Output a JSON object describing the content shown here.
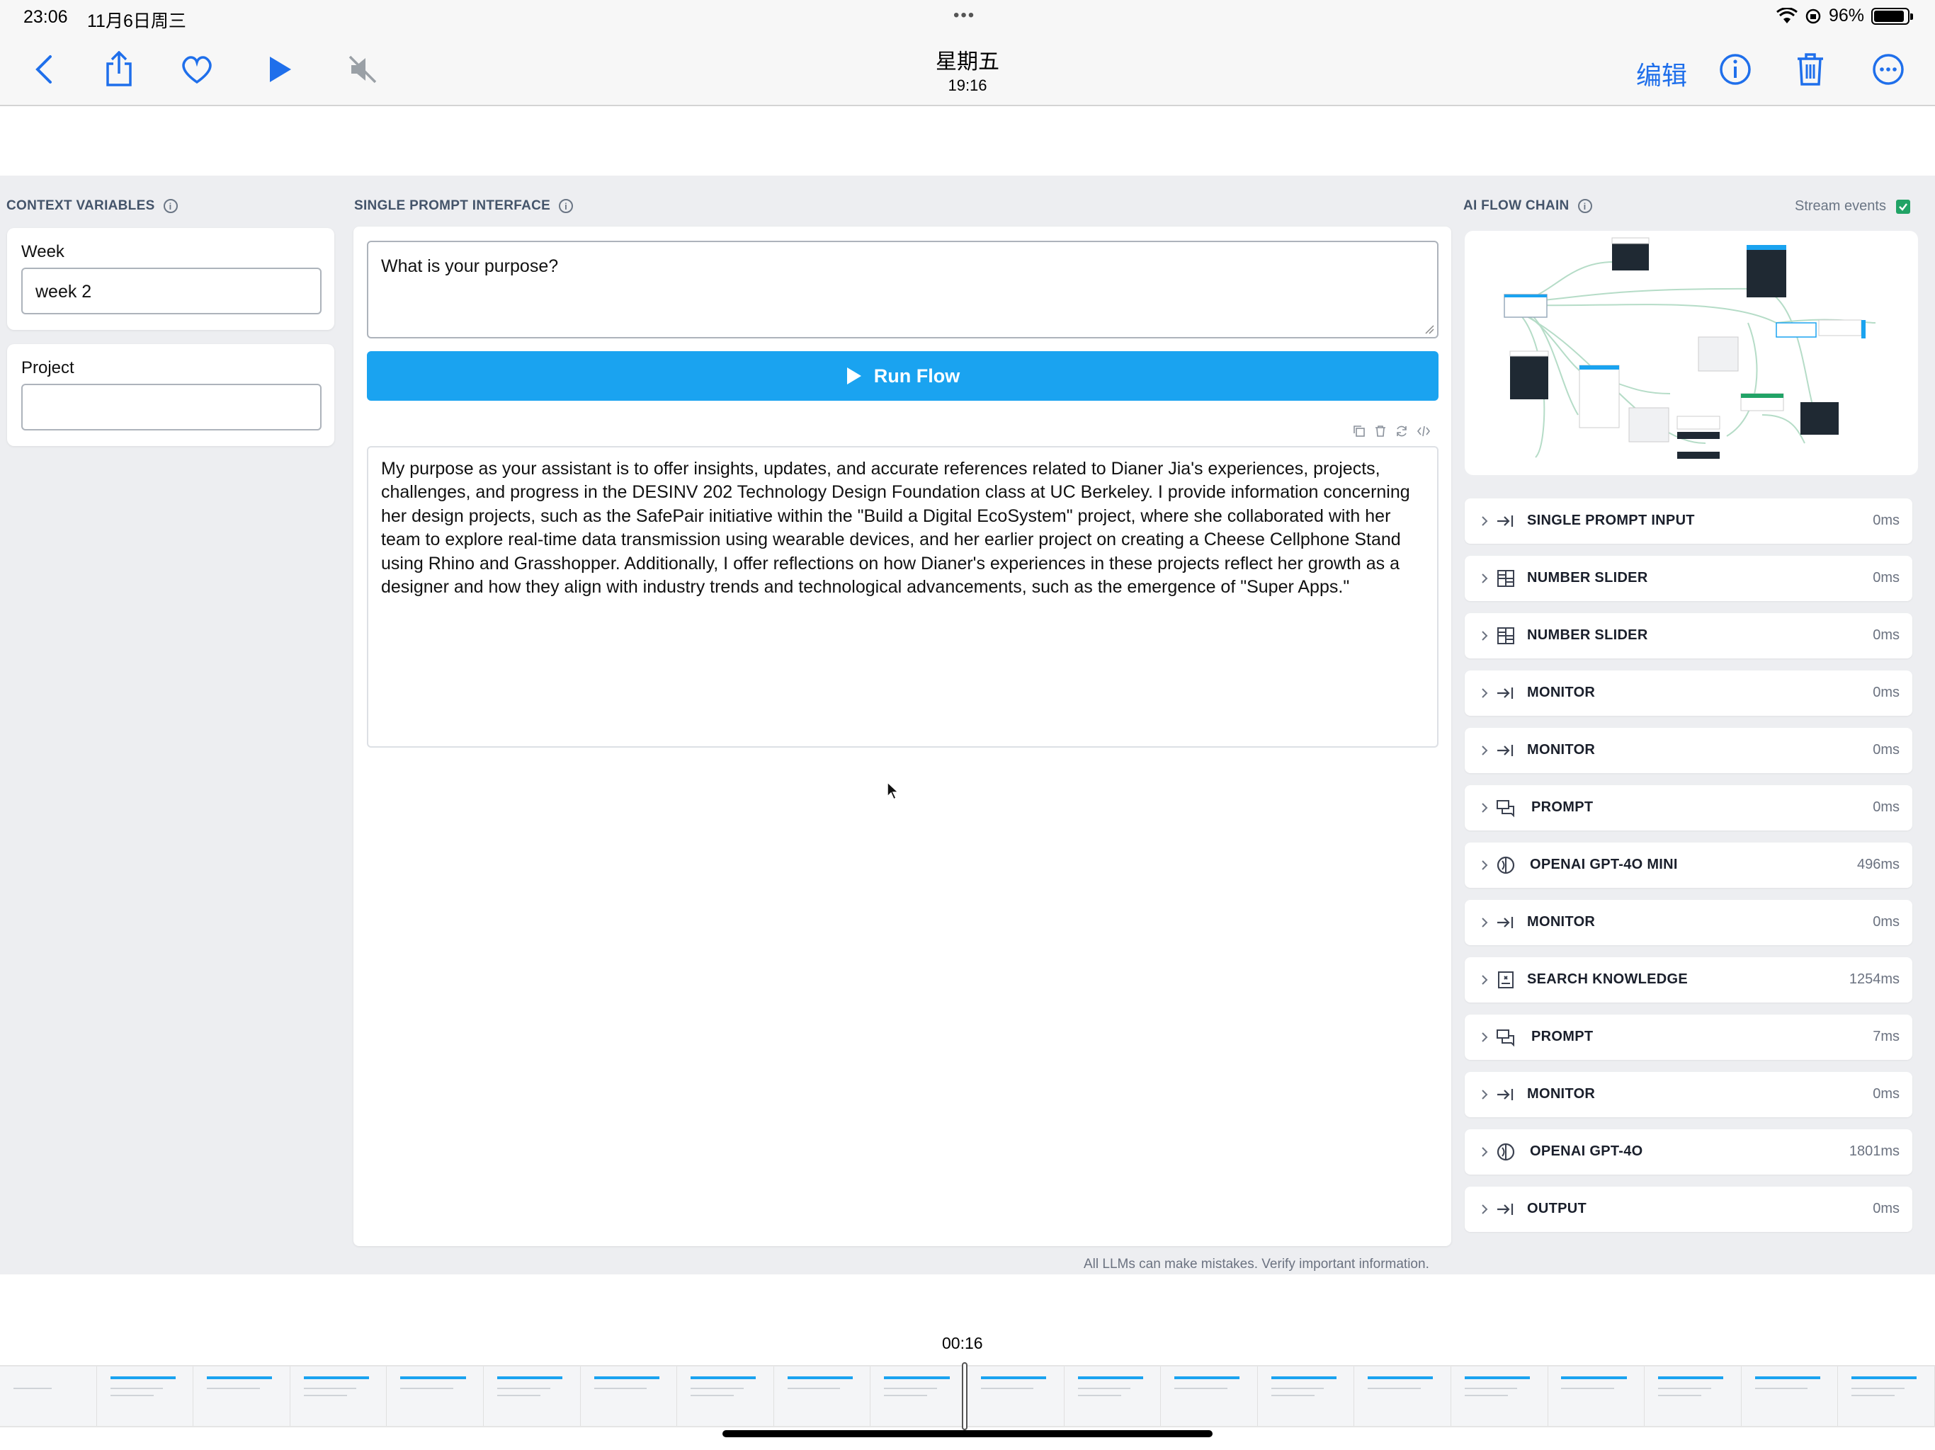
{
  "status": {
    "time": "23:06",
    "date": "11月6日周三",
    "battery": "96%"
  },
  "toolbar": {
    "title": "星期五",
    "subtitle": "19:16",
    "edit": "编辑"
  },
  "context": {
    "title": "CONTEXT VARIABLES",
    "fields": [
      {
        "label": "Week",
        "value": "week 2"
      },
      {
        "label": "Project",
        "value": ""
      }
    ]
  },
  "prompt": {
    "title": "SINGLE PROMPT INTERFACE",
    "input": "What is your purpose?",
    "run_label": "Run Flow",
    "response": "My purpose as your assistant is to offer insights, updates, and accurate references related to Dianer Jia's experiences, projects, challenges, and progress in the DESINV 202 Technology Design Foundation class at UC Berkeley. I provide information concerning her design projects, such as the SafePair initiative within the \"Build a Digital EcoSystem\" project, where she collaborated with her team to explore real-time data transmission using wearable devices, and her earlier project on creating a Cheese Cellphone Stand using Rhino and Grasshopper. Additionally, I offer reflections on how Dianer's experiences in these projects reflect her growth as a designer and how they align with industry trends and technological advancements, such as the emergence of \"Super Apps.\"",
    "disclaimer": "All LLMs can make mistakes. Verify important information."
  },
  "flow": {
    "title": "AI FLOW CHAIN",
    "stream_label": "Stream events",
    "stream_checked": true,
    "steps": [
      {
        "name": "SINGLE PROMPT INPUT",
        "time": "0ms",
        "icon": "input-icon"
      },
      {
        "name": "NUMBER SLIDER",
        "time": "0ms",
        "icon": "grid-icon"
      },
      {
        "name": "NUMBER SLIDER",
        "time": "0ms",
        "icon": "grid-icon"
      },
      {
        "name": "MONITOR",
        "time": "0ms",
        "icon": "input-icon"
      },
      {
        "name": "MONITOR",
        "time": "0ms",
        "icon": "input-icon"
      },
      {
        "name": "PROMPT",
        "time": "0ms",
        "icon": "chat-icon"
      },
      {
        "name": "OPENAI GPT-4O MINI",
        "time": "496ms",
        "icon": "openai-icon"
      },
      {
        "name": "MONITOR",
        "time": "0ms",
        "icon": "input-icon"
      },
      {
        "name": "SEARCH KNOWLEDGE",
        "time": "1254ms",
        "icon": "book-icon"
      },
      {
        "name": "PROMPT",
        "time": "7ms",
        "icon": "chat-icon"
      },
      {
        "name": "MONITOR",
        "time": "0ms",
        "icon": "input-icon"
      },
      {
        "name": "OPENAI GPT-4O",
        "time": "1801ms",
        "icon": "openai-icon"
      },
      {
        "name": "OUTPUT",
        "time": "0ms",
        "icon": "input-icon"
      }
    ]
  },
  "player": {
    "current_time": "00:16"
  },
  "colors": {
    "accent": "#1aa3f0",
    "ios_blue": "#1f6feb",
    "check": "#21a366"
  }
}
